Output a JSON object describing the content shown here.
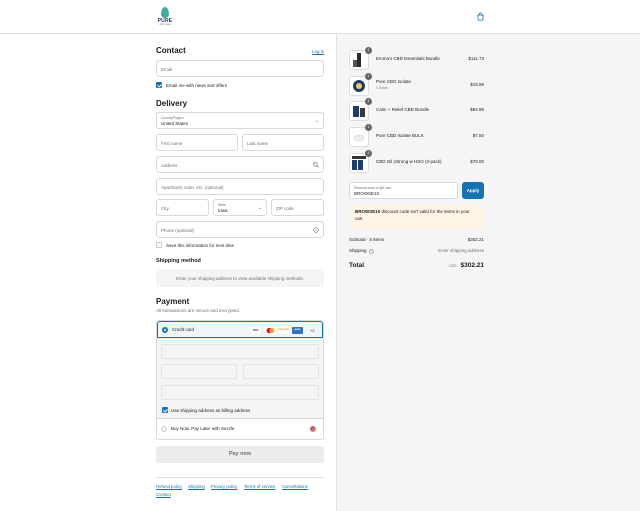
{
  "brand": {
    "name": "PURE",
    "tagline": "SPECTRUM",
    "accent": "#1773b0"
  },
  "contact": {
    "heading": "Contact",
    "login_link": "Log in",
    "email_placeholder": "Email",
    "news_label": "Email me with news and offers"
  },
  "delivery": {
    "heading": "Delivery",
    "country_label": "Country/Region",
    "country_value": "United States",
    "first_name": "First name",
    "last_name": "Last name",
    "address": "Address",
    "apartment": "Apartment, suite, etc. (optional)",
    "city": "City",
    "state_label": "State",
    "state_value": "Iowa",
    "zip": "ZIP code",
    "phone": "Phone (optional)",
    "save_info": "Save this information for next time"
  },
  "shipping_method": {
    "heading": "Shipping method",
    "message": "Enter your shipping address to view available shipping methods."
  },
  "payment": {
    "heading": "Payment",
    "subtitle": "All transactions are secure and encrypted.",
    "credit_card": "Credit card",
    "brands": [
      "VISA",
      "MC",
      "DISCOVER",
      "AMEX"
    ],
    "more_brands": "+2",
    "billing_same": "Use shipping address as billing address",
    "sezzle": "Buy Now, Pay Later with Sezzle",
    "pay_now": "Pay now"
  },
  "footer_links": [
    "Refund policy",
    "Shipping",
    "Privacy policy",
    "Terms of service",
    "Cancellations",
    "Contact"
  ],
  "cart": {
    "items": [
      {
        "name": "Emma's CBD Essentials Bundle",
        "variant": "",
        "qty": "1",
        "price": "$111.73"
      },
      {
        "name": "Pure CBG Isolate",
        "variant": "1 Gram",
        "qty": "1",
        "price": "$19.99"
      },
      {
        "name": "Calm + Relief CBD Bundle",
        "variant": "",
        "qty": "1",
        "price": "$84.99"
      },
      {
        "name": "Pure CBD Isolate BULK",
        "variant": "",
        "qty": "1",
        "price": "$7.50"
      },
      {
        "name": "CBD Oil (Strong w HSO (2-pack)",
        "variant": "",
        "qty": "1",
        "price": "$78.00"
      }
    ],
    "discount_label": "Discount code or gift card",
    "discount_value": "BROWSE10",
    "apply": "Apply",
    "warning_code": "BROWSE10",
    "warning_text": " discount code isn't valid for the items in your cart",
    "subtotal_label": "Subtotal · 5 items",
    "subtotal_value": "$302.21",
    "shipping_label": "Shipping",
    "shipping_value": "Enter shipping address",
    "total_label": "Total",
    "currency": "USD",
    "total_value": "$302.21"
  }
}
